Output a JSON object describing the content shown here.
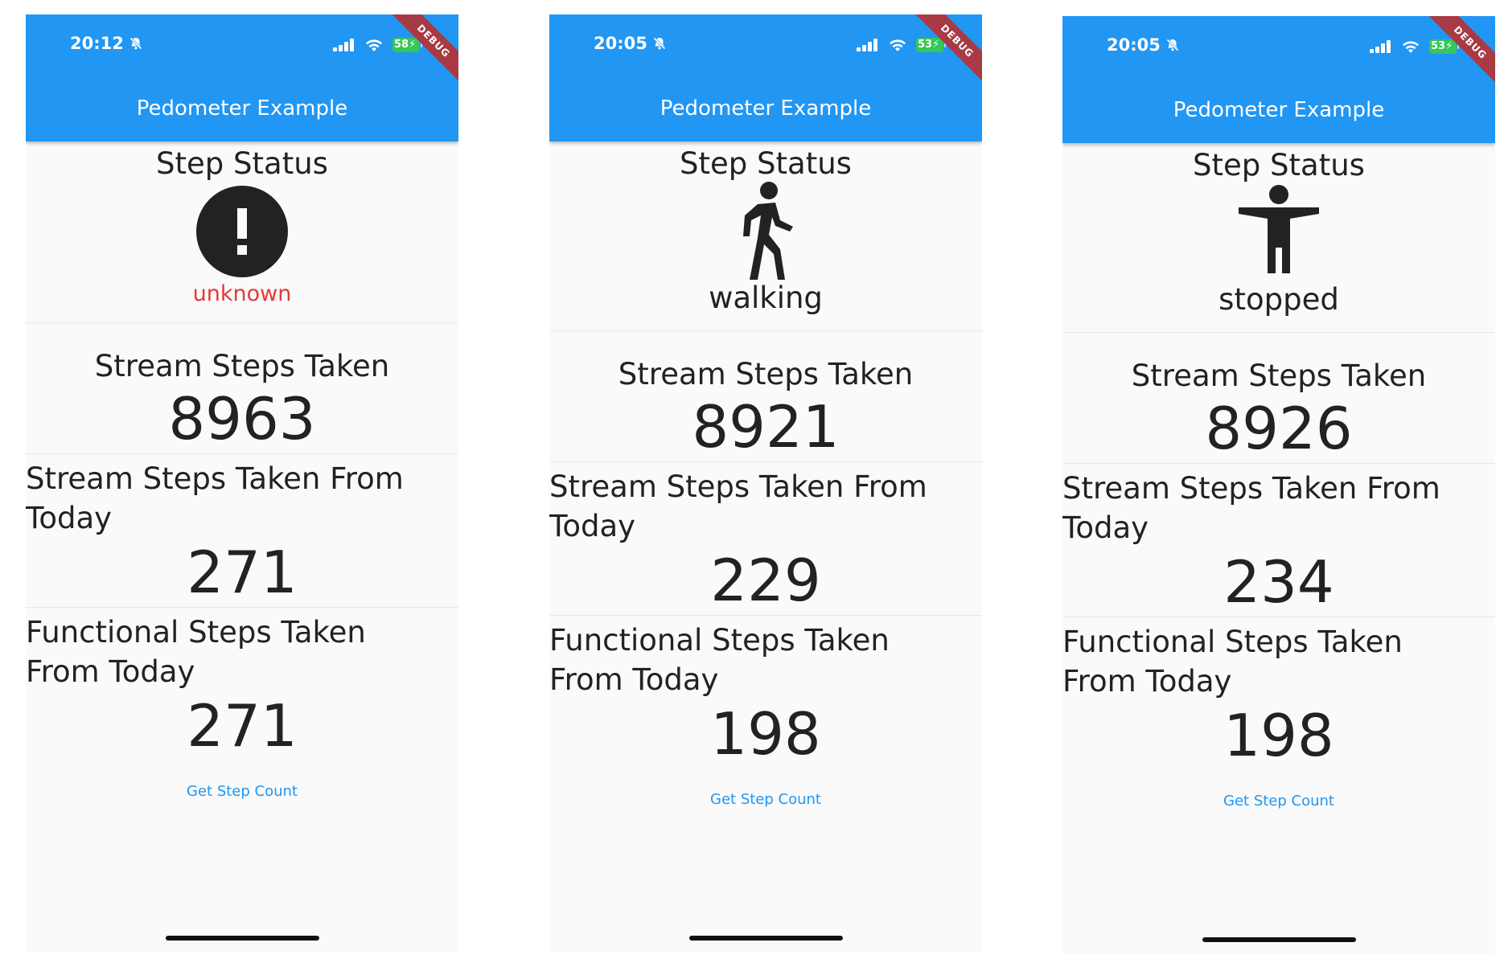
{
  "colors": {
    "appbar": "#2196f3",
    "unknown": "#e53935",
    "battery": "#34c759",
    "ribbon": "#a83a44",
    "link": "#2196f3"
  },
  "screens": [
    {
      "status_bar": {
        "time": "20:12",
        "battery": "58"
      },
      "debug_label": "DEBUG",
      "app_title": "Pedometer Example",
      "step_status_title": "Step Status",
      "status_icon": "error-icon",
      "status_text": "unknown",
      "stream_steps_title": "Stream Steps Taken",
      "stream_steps": "8963",
      "stream_today_title": "Stream Steps Taken From Today",
      "stream_today": "271",
      "functional_today_title": "Functional Steps Taken From Today",
      "functional_today": "271",
      "button_label": "Get Step Count"
    },
    {
      "status_bar": {
        "time": "20:05",
        "battery": "53"
      },
      "debug_label": "DEBUG",
      "app_title": "Pedometer Example",
      "step_status_title": "Step Status",
      "status_icon": "walking-person-icon",
      "status_text": "walking",
      "stream_steps_title": "Stream Steps Taken",
      "stream_steps": "8921",
      "stream_today_title": "Stream Steps Taken From Today",
      "stream_today": "229",
      "functional_today_title": "Functional Steps Taken From Today",
      "functional_today": "198",
      "button_label": "Get Step Count"
    },
    {
      "status_bar": {
        "time": "20:05",
        "battery": "53"
      },
      "debug_label": "DEBUG",
      "app_title": "Pedometer Example",
      "step_status_title": "Step Status",
      "status_icon": "standing-person-icon",
      "status_text": "stopped",
      "stream_steps_title": "Stream Steps Taken",
      "stream_steps": "8926",
      "stream_today_title": "Stream Steps Taken From Today",
      "stream_today": "234",
      "functional_today_title": "Functional Steps Taken From Today",
      "functional_today": "198",
      "button_label": "Get Step Count"
    }
  ]
}
